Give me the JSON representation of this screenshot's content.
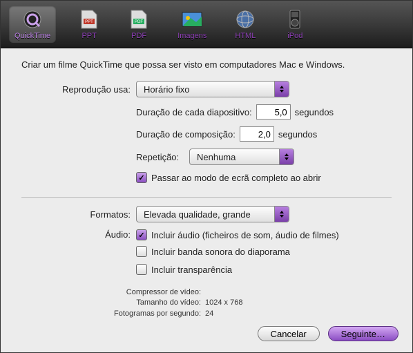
{
  "toolbar": {
    "items": [
      {
        "label": "QuickTime"
      },
      {
        "label": "PPT"
      },
      {
        "label": "PDF"
      },
      {
        "label": "Imagens"
      },
      {
        "label": "HTML"
      },
      {
        "label": "iPod"
      }
    ]
  },
  "description": "Criar um filme QuickTime que possa ser visto em computadores Mac e Windows.",
  "playback": {
    "label": "Reprodução usa:",
    "value": "Horário fixo",
    "slide_duration_label": "Duração de cada diapositivo:",
    "slide_duration_value": "5,0",
    "slide_duration_unit": "segundos",
    "composition_duration_label": "Duração de composição:",
    "composition_duration_value": "2,0",
    "composition_duration_unit": "segundos",
    "repeat_label": "Repetição:",
    "repeat_value": "Nenhuma",
    "fullscreen_checkbox": "Passar ao modo de ecrã completo ao abrir"
  },
  "formats": {
    "label": "Formatos:",
    "value": "Elevada qualidade, grande"
  },
  "audio": {
    "label": "Áudio:",
    "include_audio": "Incluir áudio (ficheiros de som, áudio de filmes)",
    "include_soundtrack": "Incluir banda sonora do diaporama",
    "include_transparency": "Incluir transparência"
  },
  "video_info": {
    "compressor_label": "Compressor de vídeo:",
    "compressor_value": "",
    "size_label": "Tamanho do vídeo:",
    "size_value": "1024 x 768",
    "fps_label": "Fotogramas por segundo:",
    "fps_value": "24"
  },
  "buttons": {
    "cancel": "Cancelar",
    "next": "Seguinte…"
  }
}
